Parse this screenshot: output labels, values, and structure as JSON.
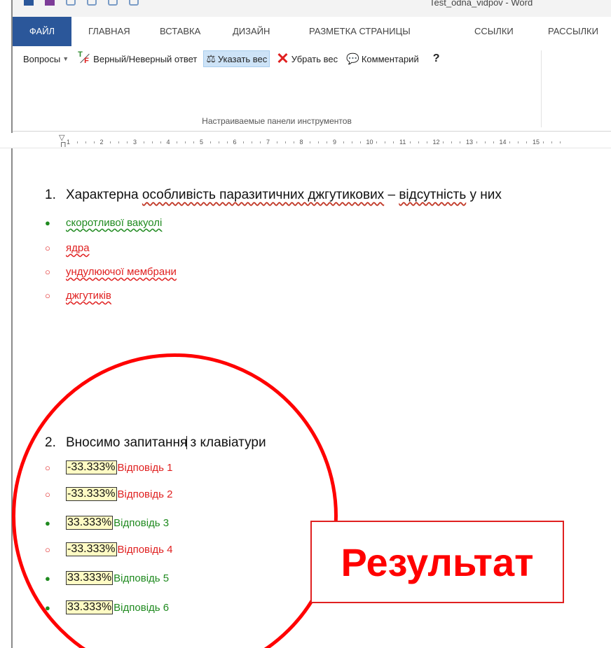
{
  "window": {
    "doc_title": "Test_odna_vidpov - Word"
  },
  "ribbon_tabs": [
    "ФАЙЛ",
    "ГЛАВНАЯ",
    "ВСТАВКА",
    "ДИЗАЙН",
    "РАЗМЕТКА СТРАНИЦЫ",
    "ССЫЛКИ",
    "РАССЫЛКИ"
  ],
  "toolbar": {
    "questions": "Вопросы",
    "true_false": "Верный/Неверный ответ",
    "set_weight": "Указать вес",
    "remove_weight": "Убрать вес",
    "comment": "Комментарий",
    "group_label": "Настраиваемые панели инструментов"
  },
  "ruler": {
    "numbers": [
      "1",
      "2",
      "3",
      "4",
      "5",
      "6",
      "7",
      "8",
      "9",
      "10",
      "11",
      "12",
      "13",
      "14",
      "15"
    ]
  },
  "question1": {
    "number": "1.",
    "text_prefix": "Характерна ",
    "text_underlined": "особливість паразитичних джгутикових",
    "text_dash": " – ",
    "text_underlined2": "відсутність",
    "text_suffix": " у них",
    "answers": [
      {
        "text": "скоротливої вакуолі",
        "correct": true
      },
      {
        "text": "ядра",
        "correct": false
      },
      {
        "text": "ундулюючої мембрани",
        "correct": false
      },
      {
        "text": "джгутиків",
        "correct": false
      }
    ]
  },
  "question2": {
    "number": "2.",
    "text_before_cursor": "Вносимо запитання",
    "text_after_cursor": " з клавіатури",
    "answers": [
      {
        "weight": "-33.333%",
        "text": "Відповідь 1",
        "correct": false
      },
      {
        "weight": "-33.333%",
        "text": "Відповідь 2",
        "correct": false
      },
      {
        "weight": "33.333%",
        "text": "Відповідь 3",
        "correct": true
      },
      {
        "weight": "-33.333%",
        "text": "Відповідь 4",
        "correct": false
      },
      {
        "weight": "33.333%",
        "text": "Відповідь 5",
        "correct": true
      },
      {
        "weight": "33.333%",
        "text": "Відповідь 6",
        "correct": true
      }
    ]
  },
  "annotation": {
    "result_label": "Результат",
    "color": "#ff0000"
  },
  "colors": {
    "ribbon_blue": "#2b579a",
    "correct_green": "#1f8a1f",
    "wrong_red": "#e02020",
    "weight_highlight": "#fffbc4"
  }
}
